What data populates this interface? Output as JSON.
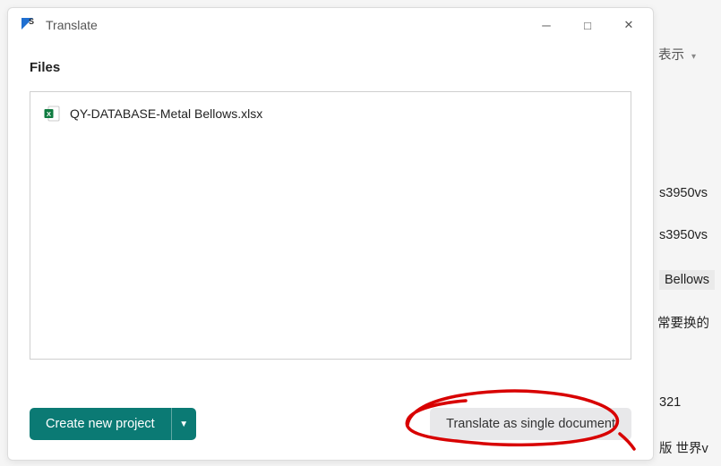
{
  "dialog": {
    "icon_name": "app-logo-icon",
    "title": "Translate",
    "files_label": "Files",
    "files": [
      {
        "name": "QY-DATABASE-Metal Bellows.xlsx",
        "icon": "excel-file-icon"
      }
    ],
    "create_project_button": "Create new project",
    "translate_button": "Translate as single document"
  },
  "window_controls": {
    "minimize_char": "─",
    "maximize_char": "□",
    "close_char": "✕"
  },
  "background_fragments": {
    "frag1": "表示",
    "frag2": "s3950vs",
    "frag3": "s3950vs",
    "frag4": "Bellows",
    "frag5": "常要换的",
    "frag6": "321",
    "frag7": "版 世界v"
  },
  "colors": {
    "primary_button_bg": "#0b7a74",
    "secondary_button_bg": "#e8e8ea",
    "border": "#cfcfcf",
    "annotation_red": "#d80000"
  }
}
